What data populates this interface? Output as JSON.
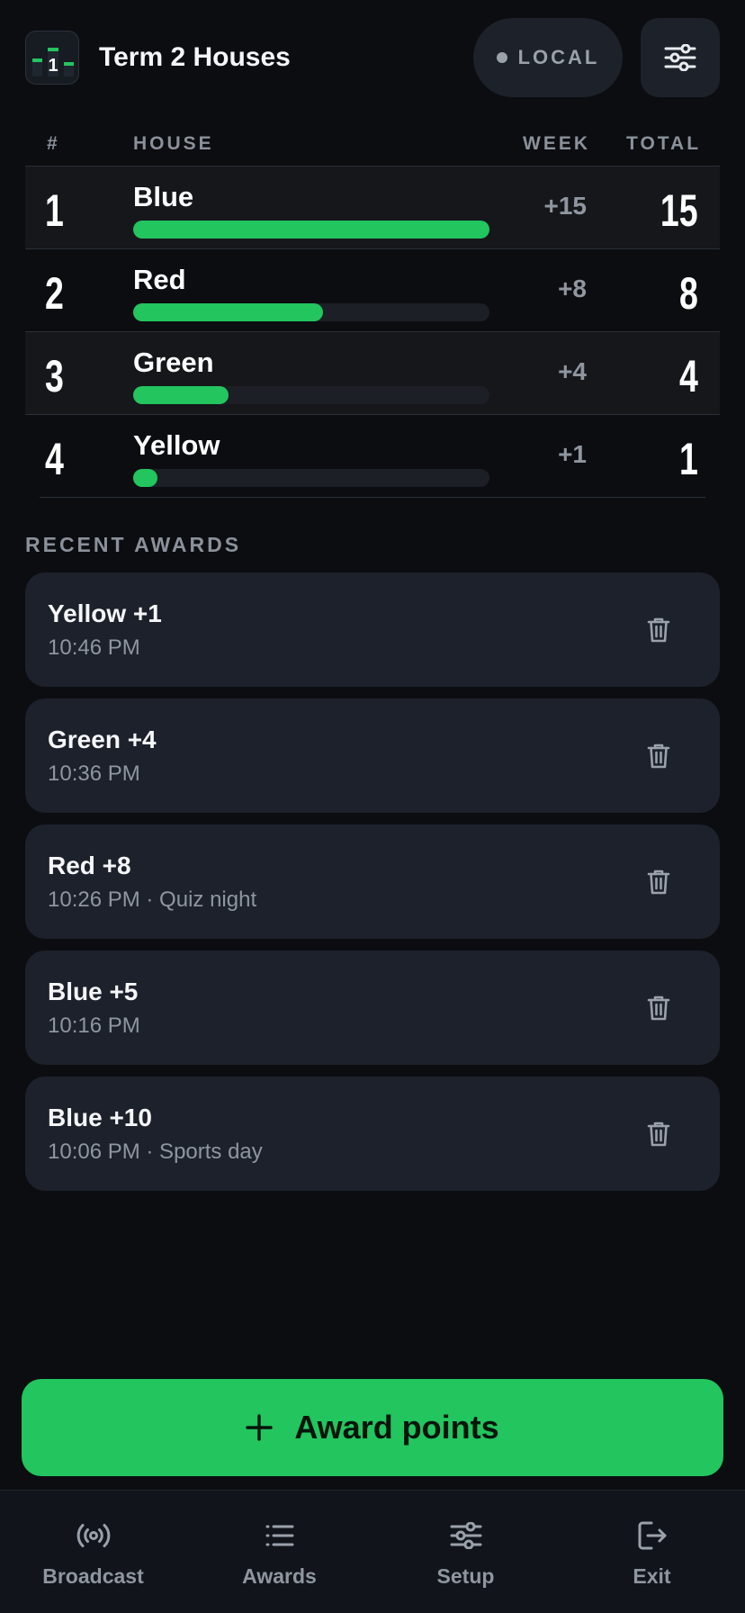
{
  "header": {
    "title": "Term 2 Houses",
    "logo_digit": "1",
    "mode_label": "LOCAL",
    "settings_icon": "sliders-icon"
  },
  "table": {
    "columns": {
      "rank": "#",
      "house": "HOUSE",
      "week": "WEEK",
      "total": "TOTAL"
    },
    "rows": [
      {
        "rank": "1",
        "house": "Blue",
        "week": "+15",
        "total": "15",
        "progress": 1.0
      },
      {
        "rank": "2",
        "house": "Red",
        "week": "+8",
        "total": "8",
        "progress": 0.533
      },
      {
        "rank": "3",
        "house": "Green",
        "week": "+4",
        "total": "4",
        "progress": 0.267
      },
      {
        "rank": "4",
        "house": "Yellow",
        "week": "+1",
        "total": "1",
        "progress": 0.067
      }
    ]
  },
  "recent": {
    "title": "RECENT AWARDS",
    "items": [
      {
        "title": "Yellow +1",
        "meta": "10:46 PM",
        "icon": "trash-icon"
      },
      {
        "title": "Green +4",
        "meta": "10:36 PM",
        "icon": "trash-icon"
      },
      {
        "title": "Red +8",
        "meta": "10:26 PM · Quiz night",
        "icon": "trash-icon"
      },
      {
        "title": "Blue +5",
        "meta": "10:16 PM",
        "icon": "trash-icon"
      },
      {
        "title": "Blue +10",
        "meta": "10:06 PM · Sports day",
        "icon": "trash-icon"
      }
    ]
  },
  "award_button": {
    "label": "Award points",
    "icon": "plus-icon"
  },
  "nav": {
    "items": [
      {
        "label": "Broadcast",
        "icon": "broadcast-icon"
      },
      {
        "label": "Awards",
        "icon": "list-icon"
      },
      {
        "label": "Setup",
        "icon": "sliders-icon"
      },
      {
        "label": "Exit",
        "icon": "exit-icon"
      }
    ]
  },
  "colors": {
    "background": "#0b0d11",
    "accent": "#22c55e",
    "card": "#1c212b",
    "muted": "#8f96a0"
  }
}
